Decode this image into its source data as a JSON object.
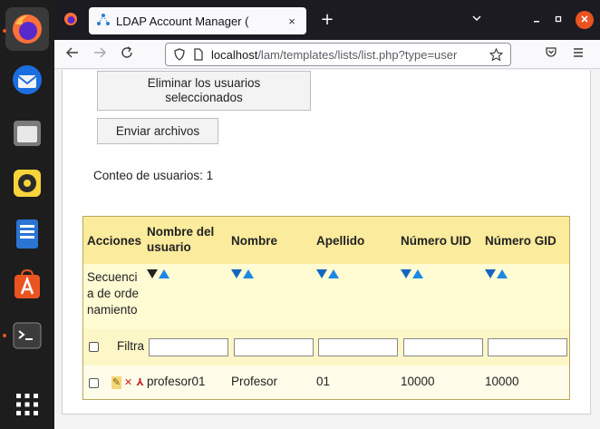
{
  "browser": {
    "tab_title": "LDAP Account Manager (",
    "tab_close": "×",
    "new_tab": "+",
    "url_host": "localhost",
    "url_path": "/lam/templates/lists/list.php?type=user"
  },
  "page": {
    "delete_button": "Eliminar los usuarios seleccionados",
    "upload_button": "Enviar archivos",
    "count_label": "Conteo de usuarios: 1"
  },
  "table": {
    "headers": [
      "Acciones",
      "Nombre del usuario",
      "Nombre",
      "Apellido",
      "Número UID",
      "Número GID"
    ],
    "sort_label": "Secuencia de ordenamiento",
    "filter_label": "Filtra",
    "rows": [
      {
        "uid": "profesor01",
        "given_name": "Profesor",
        "surname": "01",
        "uid_number": "10000",
        "gid_number": "10000"
      }
    ]
  },
  "icons": {
    "dock": [
      "firefox-icon",
      "thunderbird-icon",
      "files-icon",
      "rhythmbox-icon",
      "writer-icon",
      "software-center-icon",
      "terminal-icon",
      "app-grid-icon"
    ]
  },
  "colors": {
    "dock_bg": "#1d1d1d",
    "tabbar_bg": "#1c1b22",
    "table_header_bg": "#fbeb9c",
    "table_body_bg": "#fffde2",
    "ubuntu_orange": "#e95420"
  }
}
